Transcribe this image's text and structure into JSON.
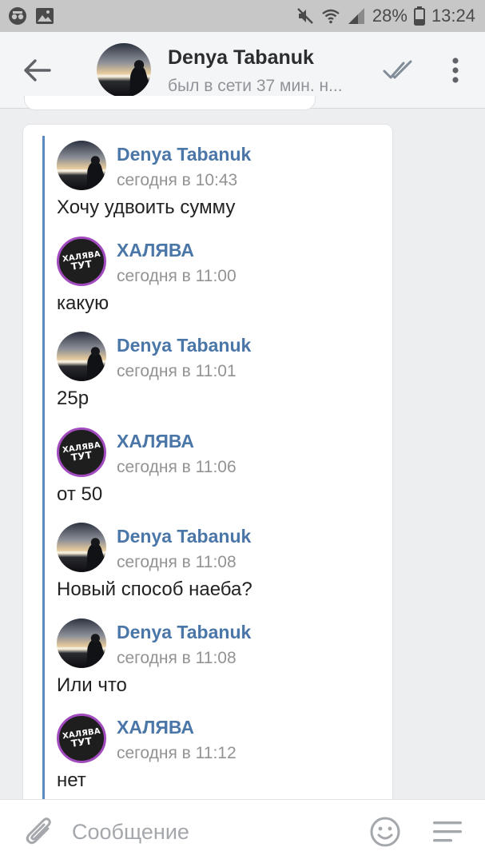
{
  "status_bar": {
    "battery": "28%",
    "time": "13:24",
    "left_icons": [
      "spy-icon",
      "image-icon"
    ],
    "right_icons": [
      "mute-icon",
      "wifi-icon",
      "signal-icon"
    ]
  },
  "header": {
    "name": "Denya Tabanuk",
    "status": "был в сети 37 мин. н...",
    "icons": [
      "back-arrow-icon",
      "double-check-icon",
      "more-vertical-icon"
    ]
  },
  "forwarded_messages": [
    {
      "author": "Denya Tabanuk",
      "avatar": "sunset",
      "time": "сегодня в 10:43",
      "text": "Хочу удвоить сумму"
    },
    {
      "author": "ХАЛЯВА",
      "avatar": "halyava",
      "time": "сегодня в 11:00",
      "text": "какую"
    },
    {
      "author": "Denya Tabanuk",
      "avatar": "sunset",
      "time": "сегодня в 11:01",
      "text": "25р"
    },
    {
      "author": "ХАЛЯВА",
      "avatar": "halyava",
      "time": "сегодня в 11:06",
      "text": "от 50"
    },
    {
      "author": "Denya Tabanuk",
      "avatar": "sunset",
      "time": "сегодня в 11:08",
      "text": "Новый способ наеба?"
    },
    {
      "author": "Denya Tabanuk",
      "avatar": "sunset",
      "time": "сегодня в 11:08",
      "text": "Или что"
    },
    {
      "author": "ХАЛЯВА",
      "avatar": "halyava",
      "time": "сегодня в 11:12",
      "text": "нет"
    }
  ],
  "halyava_logo": {
    "line1": "ХАЛЯВА",
    "line2": "ТУТ"
  },
  "input_bar": {
    "placeholder": "Сообщение",
    "value": "",
    "icons": [
      "paperclip-icon",
      "smile-icon",
      "keyboard-menu-icon"
    ]
  },
  "colors": {
    "accent": "#4a76a8",
    "forward_bar": "#5b88bd",
    "halyava_ring": "#a24bbf",
    "background": "#edeef0"
  }
}
